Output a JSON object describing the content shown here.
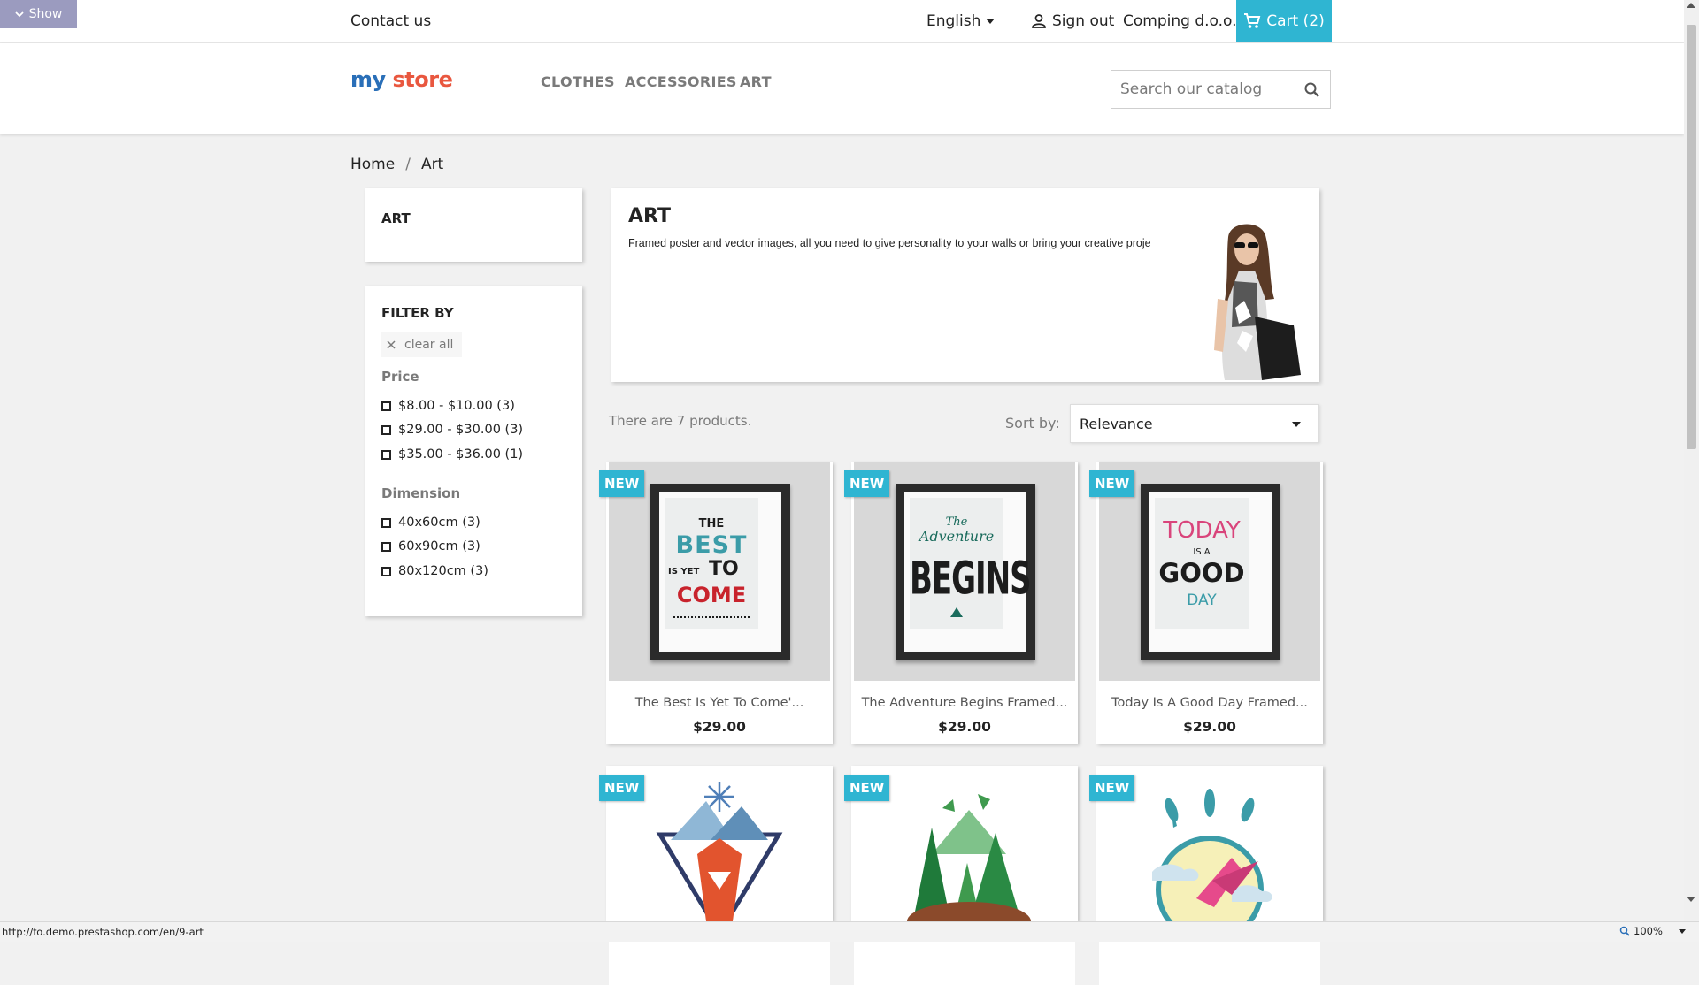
{
  "top": {
    "show_label": "Show",
    "contact": "Contact us",
    "language": "English",
    "signout": "Sign out",
    "company": "Comping d.o.o.",
    "cart": "Cart (2)"
  },
  "header": {
    "logo_part1": "my",
    "logo_part2": "store",
    "menu": [
      "CLOTHES",
      "ACCESSORIES",
      "ART"
    ],
    "search_placeholder": "Search our catalog"
  },
  "breadcrumb": [
    "Home",
    "/",
    "Art"
  ],
  "sidebar": {
    "category": "ART",
    "filter_title": "FILTER BY",
    "clear_all": "clear all",
    "price_title": "Price",
    "price": [
      "$8.00 - $10.00 (3)",
      "$29.00 - $30.00 (3)",
      "$35.00 - $36.00 (1)"
    ],
    "dimension_title": "Dimension",
    "dimension": [
      "40x60cm (3)",
      "60x90cm (3)",
      "80x120cm (3)"
    ]
  },
  "category": {
    "title": "ART",
    "description": "Framed poster and vector images, all you need to give personality to your walls or bring your creative proje"
  },
  "listing": {
    "count": "There are 7 products.",
    "sort_label": "Sort by:",
    "sort_value": "Relevance"
  },
  "products": [
    {
      "badge": "NEW",
      "name": "The Best Is Yet To Come'...",
      "price": "$29.00"
    },
    {
      "badge": "NEW",
      "name": "The Adventure Begins Framed...",
      "price": "$29.00"
    },
    {
      "badge": "NEW",
      "name": "Today Is A Good Day Framed...",
      "price": "$29.00"
    },
    {
      "badge": "NEW"
    },
    {
      "badge": "NEW"
    },
    {
      "badge": "NEW"
    }
  ],
  "poster_text": {
    "p1": [
      "THE",
      "BEST",
      "IS YET",
      "TO",
      "COME"
    ],
    "p2": [
      "The",
      "Adventure",
      "BEGINS"
    ],
    "p3": [
      "TODAY",
      "IS A",
      "GOOD",
      "DAY"
    ]
  },
  "status": {
    "url": "http://fo.demo.prestashop.com/en/9-art",
    "zoom": "100%"
  },
  "colors": {
    "accent": "#2fb5d2",
    "show_button": "#9b9bbf"
  }
}
